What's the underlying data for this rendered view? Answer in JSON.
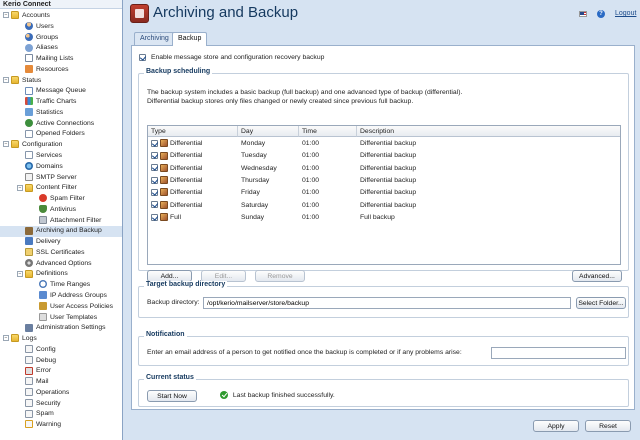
{
  "sidebar": {
    "title": "Kerio Connect",
    "items": [
      {
        "label": "Accounts",
        "toggle": "−",
        "icon": "folder"
      },
      {
        "label": "Users",
        "icon": "user"
      },
      {
        "label": "Groups",
        "icon": "group"
      },
      {
        "label": "Aliases",
        "icon": "alias"
      },
      {
        "label": "Mailing Lists",
        "icon": "list"
      },
      {
        "label": "Resources",
        "icon": "home"
      },
      {
        "label": "Status",
        "toggle": "−",
        "icon": "folder"
      },
      {
        "label": "Message Queue",
        "icon": "queue"
      },
      {
        "label": "Traffic Charts",
        "icon": "chart"
      },
      {
        "label": "Statistics",
        "icon": "stats"
      },
      {
        "label": "Active Connections",
        "icon": "conn"
      },
      {
        "label": "Opened Folders",
        "icon": "page"
      },
      {
        "label": "Configuration",
        "toggle": "−",
        "icon": "folder"
      },
      {
        "label": "Services",
        "icon": "page"
      },
      {
        "label": "Domains",
        "icon": "globe"
      },
      {
        "label": "SMTP Server",
        "icon": "mail"
      },
      {
        "label": "Content Filter",
        "toggle": "−",
        "icon": "folder"
      },
      {
        "label": "Spam Filter",
        "icon": "spam"
      },
      {
        "label": "Antivirus",
        "icon": "shield"
      },
      {
        "label": "Attachment Filter",
        "icon": "clip"
      },
      {
        "label": "Archiving and Backup",
        "icon": "archive",
        "selected": true
      },
      {
        "label": "Delivery",
        "icon": "deliv"
      },
      {
        "label": "SSL Certificates",
        "icon": "cert"
      },
      {
        "label": "Advanced Options",
        "icon": "gear"
      },
      {
        "label": "Definitions",
        "toggle": "−",
        "icon": "folder"
      },
      {
        "label": "Time Ranges",
        "icon": "clock"
      },
      {
        "label": "IP Address Groups",
        "icon": "ip"
      },
      {
        "label": "User Access Policies",
        "icon": "lock"
      },
      {
        "label": "User Templates",
        "icon": "tmpl"
      },
      {
        "label": "Administration Settings",
        "icon": "admin"
      },
      {
        "label": "Logs",
        "toggle": "−",
        "icon": "folder"
      },
      {
        "label": "Config",
        "icon": "log"
      },
      {
        "label": "Debug",
        "icon": "log"
      },
      {
        "label": "Error",
        "icon": "err"
      },
      {
        "label": "Mail",
        "icon": "log"
      },
      {
        "label": "Operations",
        "icon": "ops"
      },
      {
        "label": "Security",
        "icon": "sec"
      },
      {
        "label": "Spam",
        "icon": "log"
      },
      {
        "label": "Warning",
        "icon": "warn"
      }
    ]
  },
  "header": {
    "title": "Archiving and Backup",
    "help": "?",
    "logout": "Logout",
    "flag_icon": "us-flag-icon"
  },
  "tabs": [
    {
      "label": "Archiving",
      "active": false
    },
    {
      "label": "Backup",
      "active": true
    }
  ],
  "backup": {
    "enable_label": "Enable message store and configuration recovery backup",
    "enable_checked": true,
    "scheduling": {
      "legend": "Backup scheduling",
      "description_1": "The backup system includes a basic backup (full backup) and one advanced type of backup (differential).",
      "description_2": "Differential backup stores only files changed or newly created since previous full backup.",
      "columns": [
        "Type",
        "Day",
        "Time",
        "Description"
      ],
      "rows": [
        {
          "type": "Differential",
          "day": "Monday",
          "time": "01:00",
          "description": "Differential backup",
          "checked": true
        },
        {
          "type": "Differential",
          "day": "Tuesday",
          "time": "01:00",
          "description": "Differential backup",
          "checked": true
        },
        {
          "type": "Differential",
          "day": "Wednesday",
          "time": "01:00",
          "description": "Differential backup",
          "checked": true
        },
        {
          "type": "Differential",
          "day": "Thursday",
          "time": "01:00",
          "description": "Differential backup",
          "checked": true
        },
        {
          "type": "Differential",
          "day": "Friday",
          "time": "01:00",
          "description": "Differential backup",
          "checked": true
        },
        {
          "type": "Differential",
          "day": "Saturday",
          "time": "01:00",
          "description": "Differential backup",
          "checked": true
        },
        {
          "type": "Full",
          "day": "Sunday",
          "time": "01:00",
          "description": "Full backup",
          "checked": true
        }
      ],
      "buttons": {
        "add": "Add...",
        "edit": "Edit...",
        "remove": "Remove",
        "advanced": "Advanced..."
      }
    },
    "target": {
      "legend": "Target backup directory",
      "label": "Backup directory:",
      "value": "/opt/kerio/mailserver/store/backup",
      "select_button": "Select Folder..."
    },
    "notification": {
      "legend": "Notification",
      "label": "Enter an email address of a person to get notified once the backup is completed or if any problems arise:",
      "value": ""
    },
    "status": {
      "legend": "Current status",
      "start_button": "Start Now",
      "message": "Last backup finished successfully."
    }
  },
  "footer": {
    "apply": "Apply",
    "reset": "Reset"
  }
}
